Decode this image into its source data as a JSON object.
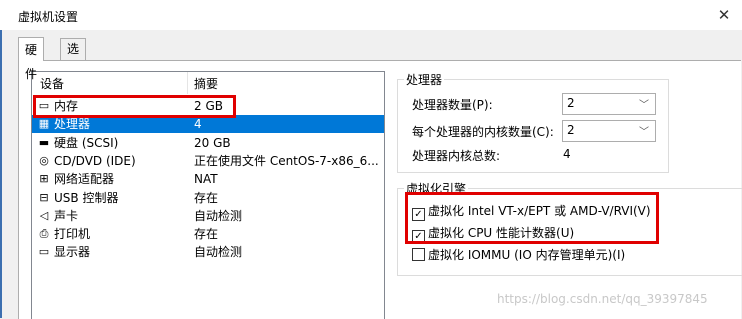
{
  "window": {
    "title": "虚拟机设置",
    "close_symbol": "✕"
  },
  "tabs": [
    {
      "label": "硬件"
    },
    {
      "label": "选项"
    }
  ],
  "device_list": {
    "headers": {
      "device": "设备",
      "summary": "摘要"
    },
    "rows": [
      {
        "icon": "memory-icon",
        "glyph": "▭",
        "name": "内存",
        "summary": "2 GB"
      },
      {
        "icon": "cpu-icon",
        "glyph": "▦",
        "name": "处理器",
        "summary": "4"
      },
      {
        "icon": "disk-icon",
        "glyph": "▬",
        "name": "硬盘 (SCSI)",
        "summary": "20 GB"
      },
      {
        "icon": "cd-icon",
        "glyph": "◎",
        "name": "CD/DVD (IDE)",
        "summary": "正在使用文件 CentOS-7-x86_6..."
      },
      {
        "icon": "network-icon",
        "glyph": "⊞",
        "name": "网络适配器",
        "summary": "NAT"
      },
      {
        "icon": "usb-icon",
        "glyph": "⊟",
        "name": "USB 控制器",
        "summary": "存在"
      },
      {
        "icon": "sound-icon",
        "glyph": "◁",
        "name": "声卡",
        "summary": "自动检测"
      },
      {
        "icon": "printer-icon",
        "glyph": "⎙",
        "name": "打印机",
        "summary": "存在"
      },
      {
        "icon": "display-icon",
        "glyph": "▭",
        "name": "显示器",
        "summary": "自动检测"
      }
    ],
    "selected_index": 1
  },
  "processor": {
    "group_title": "处理器",
    "count_label": "处理器数量(P):",
    "count_value": "2",
    "cores_label": "每个处理器的内核数量(C):",
    "cores_value": "2",
    "total_label": "处理器内核总数:",
    "total_value": "4"
  },
  "virtualization": {
    "group_title": "虚拟化引擎",
    "options": [
      {
        "label": "虚拟化 Intel VT-x/EPT 或 AMD-V/RVI(V)",
        "checked": true
      },
      {
        "label": "虚拟化 CPU 性能计数器(U)",
        "checked": true
      },
      {
        "label": "虚拟化 IOMMU (IO 内存管理单元)(I)",
        "checked": false
      }
    ]
  },
  "watermark": "https://blog.csdn.net/qq_39397845",
  "colors": {
    "selection": "#0078d7",
    "highlight_box": "#e00000"
  }
}
